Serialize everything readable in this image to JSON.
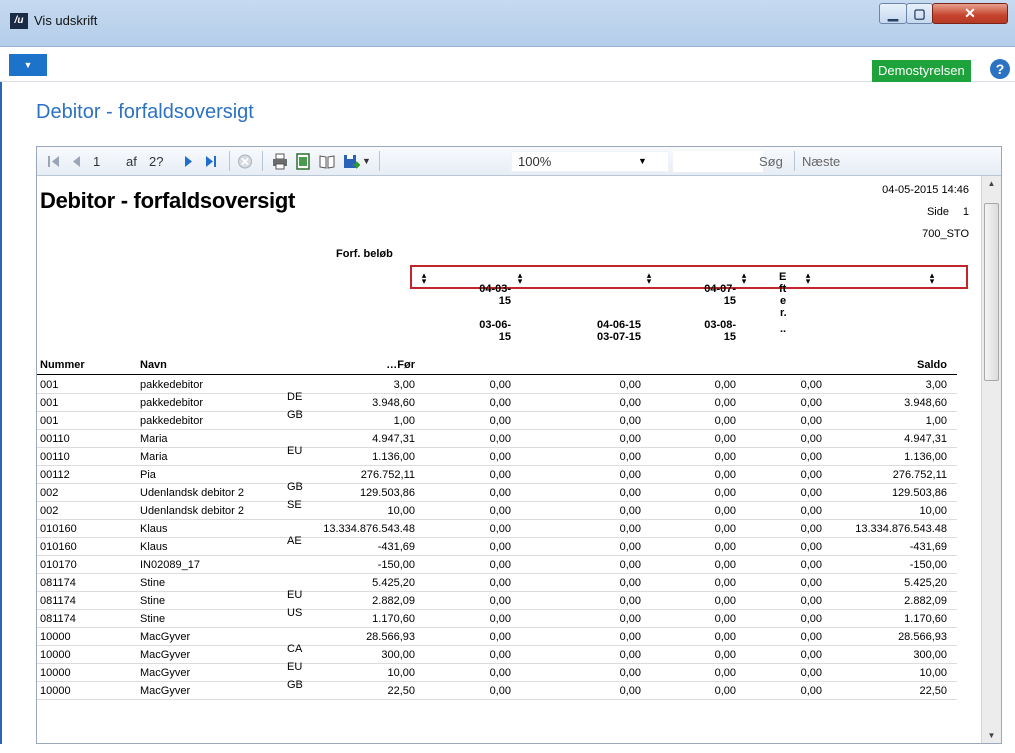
{
  "window": {
    "title": "Vis udskrift",
    "logo": "/u",
    "min_glyph": "▁",
    "max_glyph": "▢",
    "close_glyph": "✕"
  },
  "ribbon": {
    "menu_glyph": "▼",
    "company": "Demostyrelsen",
    "help": "?"
  },
  "page_title": "Debitor - forfaldsoversigt",
  "toolbar": {
    "page_current": "1",
    "page_of": "af",
    "page_total": "2?",
    "zoom": "100%",
    "search_label": "Søg",
    "next_label": "Næste"
  },
  "report": {
    "title": "Debitor - forfaldsoversigt",
    "datetime": "04-05-2015 14:46",
    "side_label": "Side",
    "side_num": "1",
    "user": "700_STO",
    "forf_label": "Forf. beløb",
    "headers": {
      "nummer": "Nummer",
      "navn": "Navn",
      "foer": "…Før",
      "p1a": "04-03-",
      "p1b": "15",
      "p1c": "03-06-",
      "p1d": "15",
      "p2a": "04-06-15",
      "p2b": "03-07-15",
      "p3a": "04-07-",
      "p3b": "15",
      "p3c": "03-08-",
      "p3d": "15",
      "eftera": "E",
      "efterb": "ft",
      "efterc": "e",
      "efterd": "r.",
      "eftere": "..",
      "saldo": "Saldo"
    },
    "rows": [
      {
        "nr": "001",
        "navn": "pakkedebitor",
        "code": "",
        "foer": "3,00",
        "p1": "0,00",
        "p2": "0,00",
        "p3": "0,00",
        "efter": "0,00",
        "saldo": "3,00"
      },
      {
        "nr": "001",
        "navn": "pakkedebitor",
        "code": "DE",
        "foer": "3.948,60",
        "p1": "0,00",
        "p2": "0,00",
        "p3": "0,00",
        "efter": "0,00",
        "saldo": "3.948,60"
      },
      {
        "nr": "001",
        "navn": "pakkedebitor",
        "code": "GB",
        "foer": "1,00",
        "p1": "0,00",
        "p2": "0,00",
        "p3": "0,00",
        "efter": "0,00",
        "saldo": "1,00"
      },
      {
        "nr": "00110",
        "navn": "Maria",
        "code": "",
        "foer": "4.947,31",
        "p1": "0,00",
        "p2": "0,00",
        "p3": "0,00",
        "efter": "0,00",
        "saldo": "4.947,31"
      },
      {
        "nr": "00110",
        "navn": "Maria",
        "code": "EU",
        "foer": "1.136,00",
        "p1": "0,00",
        "p2": "0,00",
        "p3": "0,00",
        "efter": "0,00",
        "saldo": "1.136,00"
      },
      {
        "nr": "00112",
        "navn": "Pia",
        "code": "",
        "foer": "276.752,11",
        "p1": "0,00",
        "p2": "0,00",
        "p3": "0,00",
        "efter": "0,00",
        "saldo": "276.752,11"
      },
      {
        "nr": "002",
        "navn": "Udenlandsk debitor 2",
        "code": "GB",
        "foer": "129.503,86",
        "p1": "0,00",
        "p2": "0,00",
        "p3": "0,00",
        "efter": "0,00",
        "saldo": "129.503,86"
      },
      {
        "nr": "002",
        "navn": "Udenlandsk debitor 2",
        "code": "SE",
        "foer": "10,00",
        "p1": "0,00",
        "p2": "0,00",
        "p3": "0,00",
        "efter": "0,00",
        "saldo": "10,00"
      },
      {
        "nr": "010160",
        "navn": "Klaus",
        "code": "",
        "foer": "13.334.876.543.48",
        "p1": "0,00",
        "p2": "0,00",
        "p3": "0,00",
        "efter": "0,00",
        "saldo": "13.334.876.543.48"
      },
      {
        "nr": "010160",
        "navn": "Klaus",
        "code": "AE",
        "foer": "-431,69",
        "p1": "0,00",
        "p2": "0,00",
        "p3": "0,00",
        "efter": "0,00",
        "saldo": "-431,69"
      },
      {
        "nr": "010170",
        "navn": "IN02089_17",
        "code": "",
        "foer": "-150,00",
        "p1": "0,00",
        "p2": "0,00",
        "p3": "0,00",
        "efter": "0,00",
        "saldo": "-150,00"
      },
      {
        "nr": "081174",
        "navn": "Stine",
        "code": "",
        "foer": "5.425,20",
        "p1": "0,00",
        "p2": "0,00",
        "p3": "0,00",
        "efter": "0,00",
        "saldo": "5.425,20"
      },
      {
        "nr": "081174",
        "navn": "Stine",
        "code": "EU",
        "foer": "2.882,09",
        "p1": "0,00",
        "p2": "0,00",
        "p3": "0,00",
        "efter": "0,00",
        "saldo": "2.882,09"
      },
      {
        "nr": "081174",
        "navn": "Stine",
        "code": "US",
        "foer": "1.170,60",
        "p1": "0,00",
        "p2": "0,00",
        "p3": "0,00",
        "efter": "0,00",
        "saldo": "1.170,60"
      },
      {
        "nr": "10000",
        "navn": "MacGyver",
        "code": "",
        "foer": "28.566,93",
        "p1": "0,00",
        "p2": "0,00",
        "p3": "0,00",
        "efter": "0,00",
        "saldo": "28.566,93"
      },
      {
        "nr": "10000",
        "navn": "MacGyver",
        "code": "CA",
        "foer": "300,00",
        "p1": "0,00",
        "p2": "0,00",
        "p3": "0,00",
        "efter": "0,00",
        "saldo": "300,00"
      },
      {
        "nr": "10000",
        "navn": "MacGyver",
        "code": "EU",
        "foer": "10,00",
        "p1": "0,00",
        "p2": "0,00",
        "p3": "0,00",
        "efter": "0,00",
        "saldo": "10,00"
      },
      {
        "nr": "10000",
        "navn": "MacGyver",
        "code": "GB",
        "foer": "22,50",
        "p1": "0,00",
        "p2": "0,00",
        "p3": "0,00",
        "efter": "0,00",
        "saldo": "22,50"
      }
    ]
  },
  "icons": [
    "first-page-icon",
    "prev-page-icon",
    "next-page-icon",
    "last-page-icon",
    "stop-icon",
    "print-icon",
    "print-layout-icon",
    "page-setup-icon",
    "export-icon",
    "zoom-dropdown-icon",
    "sort-icon"
  ]
}
